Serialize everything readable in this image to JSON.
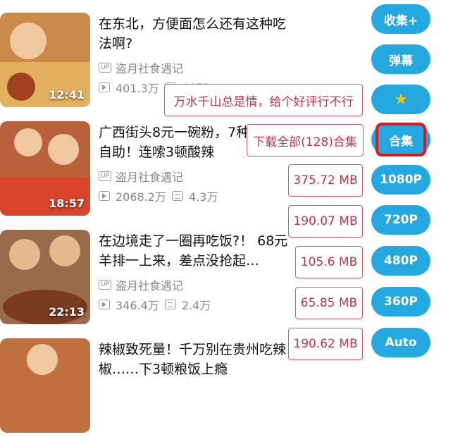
{
  "videos": [
    {
      "title": "在东北，方便面怎么还有这种吃法啊?",
      "uploader": "盗月社食遇记",
      "views": "401.3万",
      "danmaku": "6073",
      "duration": "12:41"
    },
    {
      "title": "广西街头8元一碗粉，7种无限自助！连嗦3顿酸辣",
      "uploader": "盗月社食遇记",
      "views": "2068.2万",
      "danmaku": "4.3万",
      "duration": "18:57"
    },
    {
      "title": "在边境走了一圈再吃饭?！ 68元羊排一上来，差点没抢起…",
      "uploader": "盗月社食遇记",
      "views": "346.4万",
      "danmaku": "2.4万",
      "duration": "22:13"
    },
    {
      "title": "辣椒致死量！千万别在贵州吃辣椒……下3顿粮饭上瘾",
      "uploader": "",
      "views": "",
      "danmaku": "",
      "duration": ""
    }
  ],
  "up_badge": "UP",
  "buttons": {
    "favorite": "收集+",
    "danmaku": "弹幕",
    "star": "★",
    "collection": "合集",
    "q1080": "1080P",
    "q720": "720P",
    "q480": "480P",
    "q360": "360P",
    "auto": "Auto"
  },
  "tooltips": {
    "review": "万水千山总是情，给个好评行不行",
    "download_all": "下载全部(128)合集"
  },
  "sizes": {
    "s1080": "375.72 MB",
    "s720": "190.07 MB",
    "s480": "105.6 MB",
    "s360": "65.85 MB",
    "sauto": "190.62 MB"
  },
  "colors": {
    "accent": "#23a8e0",
    "warn": "#c83246",
    "highlight": "#e01818"
  }
}
